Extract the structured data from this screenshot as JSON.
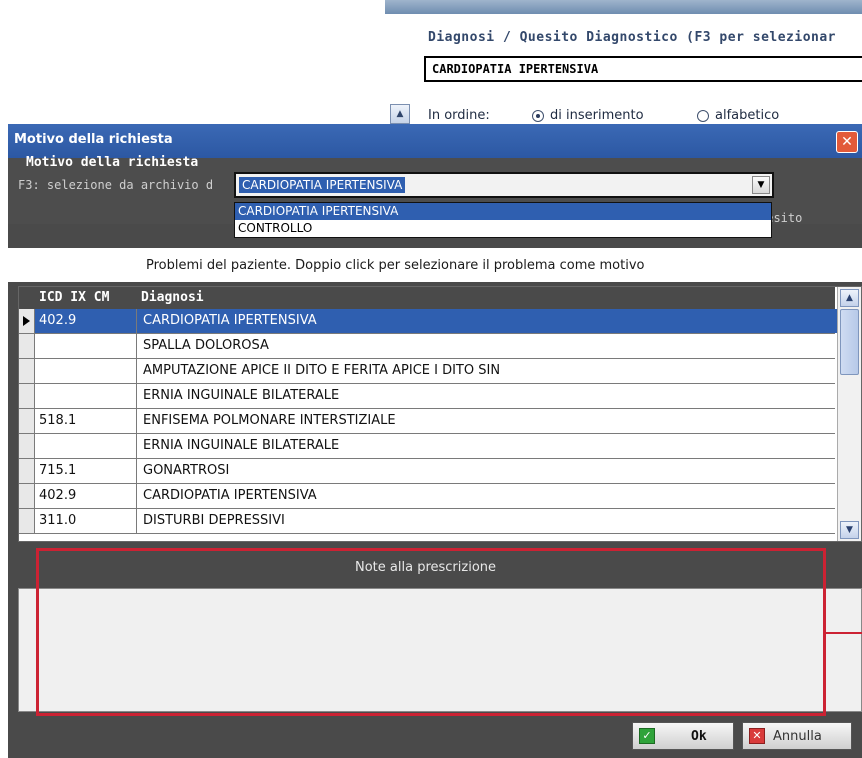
{
  "background_window": {
    "diagnosis_title": "Diagnosi / Quesito Diagnostico (F3 per selezionar",
    "diagnosis_value": "CARDIOPATIA IPERTENSIVA",
    "order_label": "In ordine:",
    "order_options": [
      "di inserimento",
      "alfabetico"
    ],
    "order_selected": "di inserimento"
  },
  "dialog": {
    "title": "Motivo della richiesta",
    "close_glyph": "✕",
    "motivo_label": "Motivo della richiesta",
    "motivo_value": "CARDIOPATIA IPERTENSIVA",
    "dropdown_options": [
      "CARDIOPATIA IPERTENSIVA",
      "CONTROLLO"
    ],
    "f3_note_start": "F3: selezione da archivio d",
    "f3_note_end": "uesito",
    "problems_caption": "Problemi del paziente. Doppio click per selezionare il problema come motivo",
    "table": {
      "headers": [
        "ICD IX CM",
        "Diagnosi"
      ],
      "rows": [
        {
          "code": "402.9",
          "diagnosis": "CARDIOPATIA IPERTENSIVA"
        },
        {
          "code": "",
          "diagnosis": "SPALLA DOLOROSA"
        },
        {
          "code": "",
          "diagnosis": "AMPUTAZIONE APICE II DITO E FERITA APICE I DITO SIN"
        },
        {
          "code": "",
          "diagnosis": "ERNIA INGUINALE BILATERALE"
        },
        {
          "code": "518.1",
          "diagnosis": "ENFISEMA POLMONARE INTERSTIZIALE"
        },
        {
          "code": "",
          "diagnosis": "ERNIA INGUINALE BILATERALE"
        },
        {
          "code": "715.1",
          "diagnosis": "GONARTROSI"
        },
        {
          "code": "402.9",
          "diagnosis": "CARDIOPATIA IPERTENSIVA"
        },
        {
          "code": "311.0",
          "diagnosis": "DISTURBI DEPRESSIVI"
        }
      ]
    },
    "notes_title": "Note alla prescrizione",
    "notes_value": "",
    "ok_label": "Ok",
    "cancel_label": "Annulla"
  },
  "colors": {
    "selection": "#2f5fb0",
    "dialog_bg": "#4a4a4a",
    "highlight_box": "#cc2233"
  }
}
